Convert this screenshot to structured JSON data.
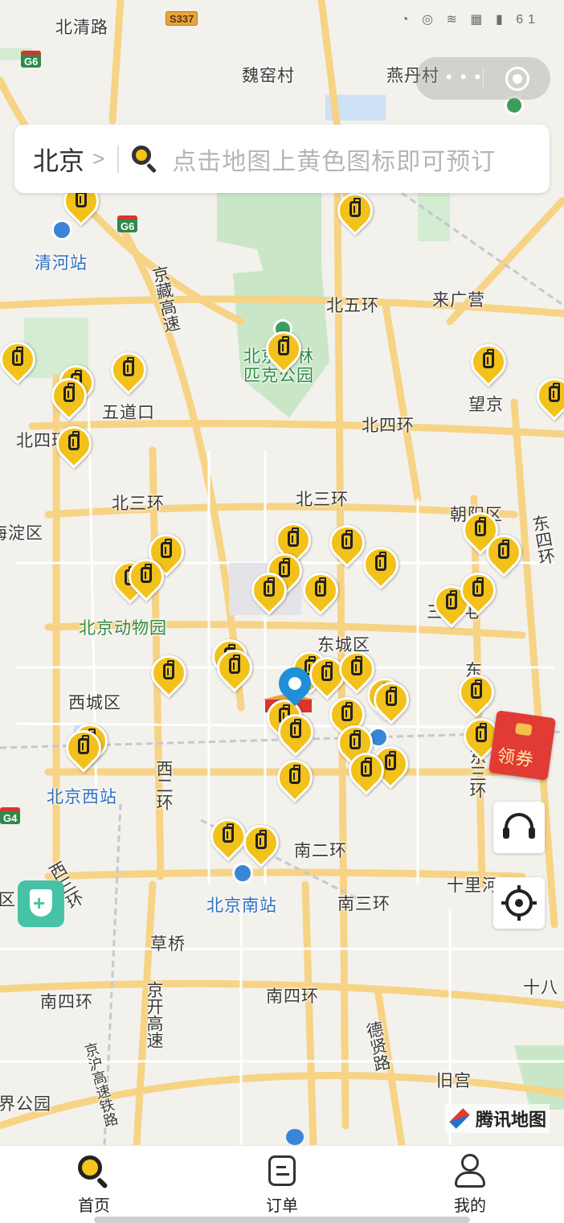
{
  "status_bar": {
    "icons": "◔ ◎ ≋ ▦ ▮ 61"
  },
  "capsule": {
    "more_icon": "more-dots-icon",
    "close_icon": "target-icon"
  },
  "search": {
    "city": "北京",
    "placeholder": "点击地图上黄色图标即可预订"
  },
  "map_labels": {
    "beiqinglu": "北清路",
    "weiyaocun": "魏窑村",
    "yandancun": "燕丹村",
    "qinghezhan": "清河站",
    "jingzanggaosu": "京藏高速",
    "beiwuhuan": "北五环",
    "laiguangying": "来广营",
    "olympic": "北京奥林匹克公园",
    "wudaokou": "五道口",
    "wangjing": "望京",
    "beisihuan_w": "北四环",
    "beisihuan": "北四环",
    "beisanhuan_w": "北三环",
    "beisanhuan": "北三环",
    "chaoyangqu": "朝阳区",
    "dongsihuan": "东四环",
    "haidianqu": "海淀区",
    "zoo": "北京动物园",
    "dongchengqu": "东城区",
    "xichengqu": "西城区",
    "dongsanhuan": "东三环",
    "beijingxizhan": "北京西站",
    "xierhuan": "西二环",
    "nanerhuan": "南二环",
    "beijingnanzhan": "北京南站",
    "xisanhuan": "西三环",
    "nansanhuan": "南三环",
    "shilihe": "十里河",
    "caoqiao": "草桥",
    "nansihuan_w": "南四环",
    "nansihuan": "南四环",
    "jingkaigaosu": "京开高速",
    "dexianlu": "德贤路",
    "jinghugaotie": "京沪高速铁路",
    "jiugong": "旧宫",
    "shijiegongyuan": "界公园",
    "shiba": "十八",
    "sanlitun": "三里屯",
    "qu": "区",
    "dong": "东"
  },
  "road_shields": {
    "s337": "S337",
    "g6_a": "G6",
    "g6_b": "G6",
    "g4": "G4"
  },
  "coupon": {
    "label": "领券"
  },
  "brand": {
    "name": "腾讯地图"
  },
  "tabs": [
    {
      "label": "首页",
      "icon": "search-icon"
    },
    {
      "label": "订单",
      "icon": "order-icon"
    },
    {
      "label": "我的",
      "icon": "profile-icon"
    }
  ],
  "colors": {
    "pin": "#f2c21b",
    "location": "#1f8fd8",
    "shield_button": "#46c3a6",
    "coupon": "#e23b34"
  }
}
